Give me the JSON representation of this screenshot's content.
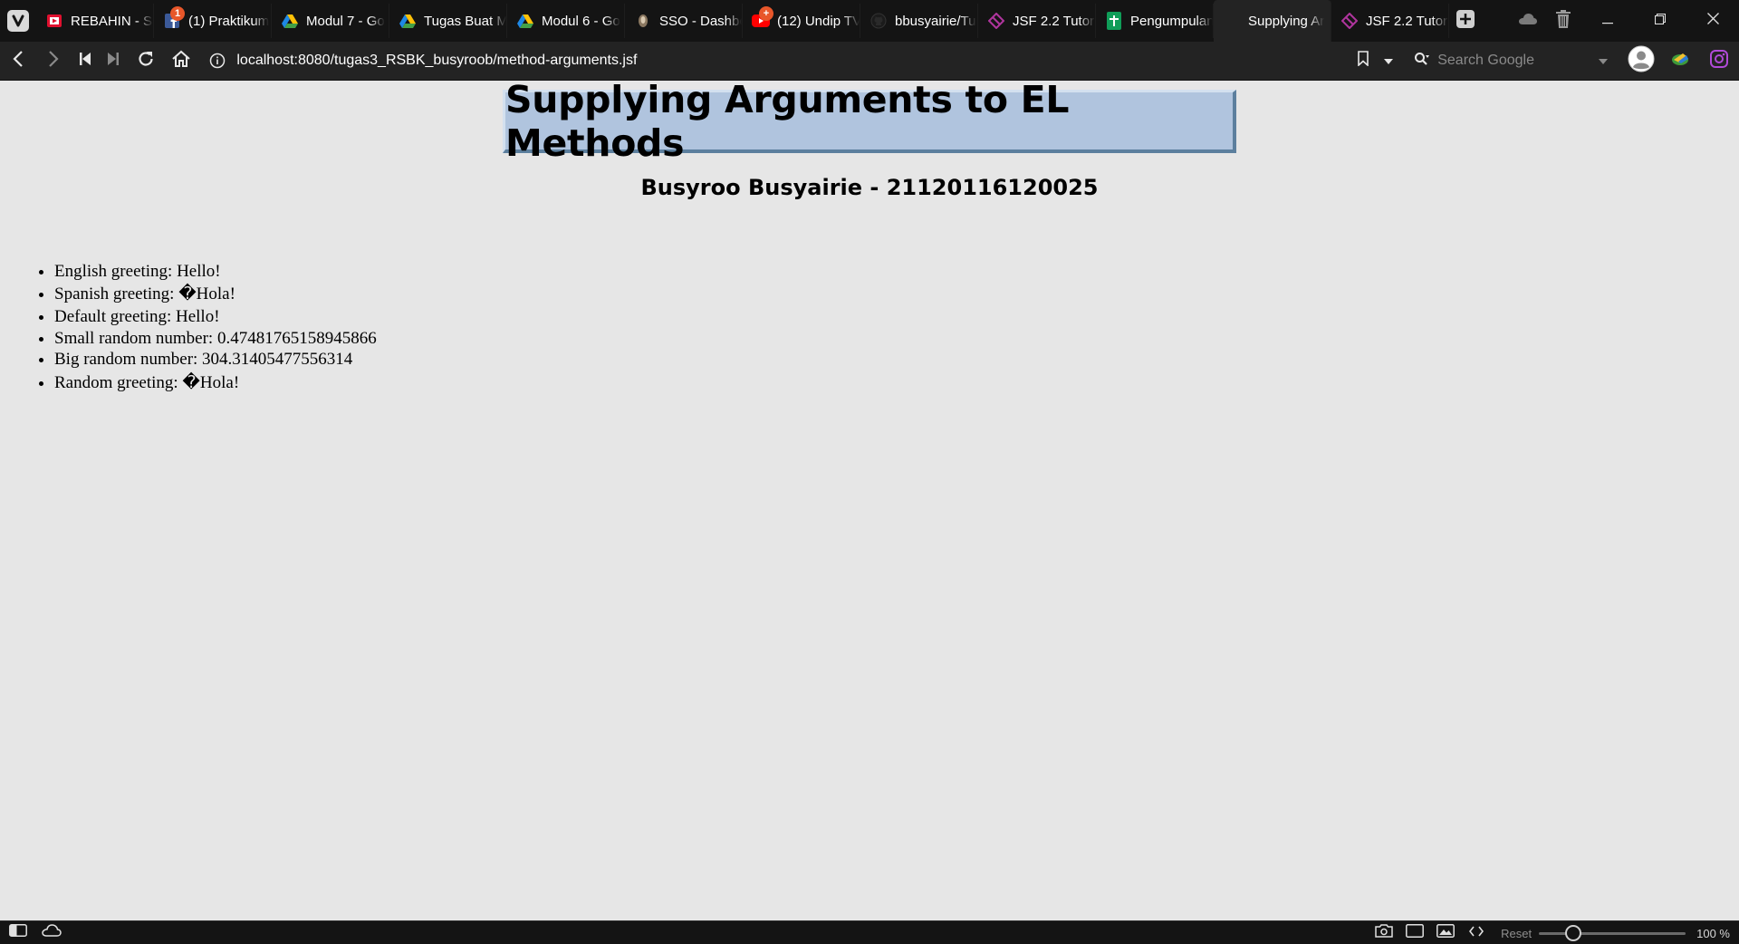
{
  "browser": {
    "tabs": [
      {
        "title": "REBAHIN - Si",
        "icon": "rebahin-icon",
        "active": false
      },
      {
        "title": "(1) Praktikum",
        "icon": "facebook-icon",
        "badge": "1",
        "active": false
      },
      {
        "title": "Modul 7 - Go",
        "icon": "google-drive-icon",
        "active": false
      },
      {
        "title": "Tugas Buat M",
        "icon": "google-drive-icon",
        "active": false
      },
      {
        "title": "Modul 6 - Go",
        "icon": "google-drive-icon",
        "active": false
      },
      {
        "title": "SSO - Dashbo",
        "icon": "sso-icon",
        "active": false
      },
      {
        "title": "(12) Undip TV",
        "icon": "youtube-icon",
        "badge": "+",
        "active": false
      },
      {
        "title": "bbusyairie/Tu",
        "icon": "github-icon",
        "active": false
      },
      {
        "title": "JSF 2.2 Tutori",
        "icon": "jsf-icon",
        "active": false
      },
      {
        "title": "Pengumpulan",
        "icon": "google-sheets-icon",
        "active": false
      },
      {
        "title": "Supplying Ar",
        "icon": "blank-page-icon",
        "active": true
      },
      {
        "title": "JSF 2.2 Tutori",
        "icon": "jsf-icon",
        "active": false
      }
    ],
    "url": "localhost:8080/tugas3_RSBK_busyroob/method-arguments.jsf",
    "search_placeholder": "Search Google",
    "status": {
      "reset_label": "Reset",
      "zoom_level": "100 %",
      "zoom_fraction": 0.2
    }
  },
  "page": {
    "title": "Supplying Arguments to EL Methods",
    "subtitle": "Busyroo Busyairie - 21120116120025",
    "results": [
      "English greeting: Hello!",
      "Spanish greeting: �Hola!",
      "Default greeting: Hello!",
      "Small random number: 0.47481765158945866",
      "Big random number: 304.31405477556314",
      "Random greeting: �Hola!"
    ]
  }
}
